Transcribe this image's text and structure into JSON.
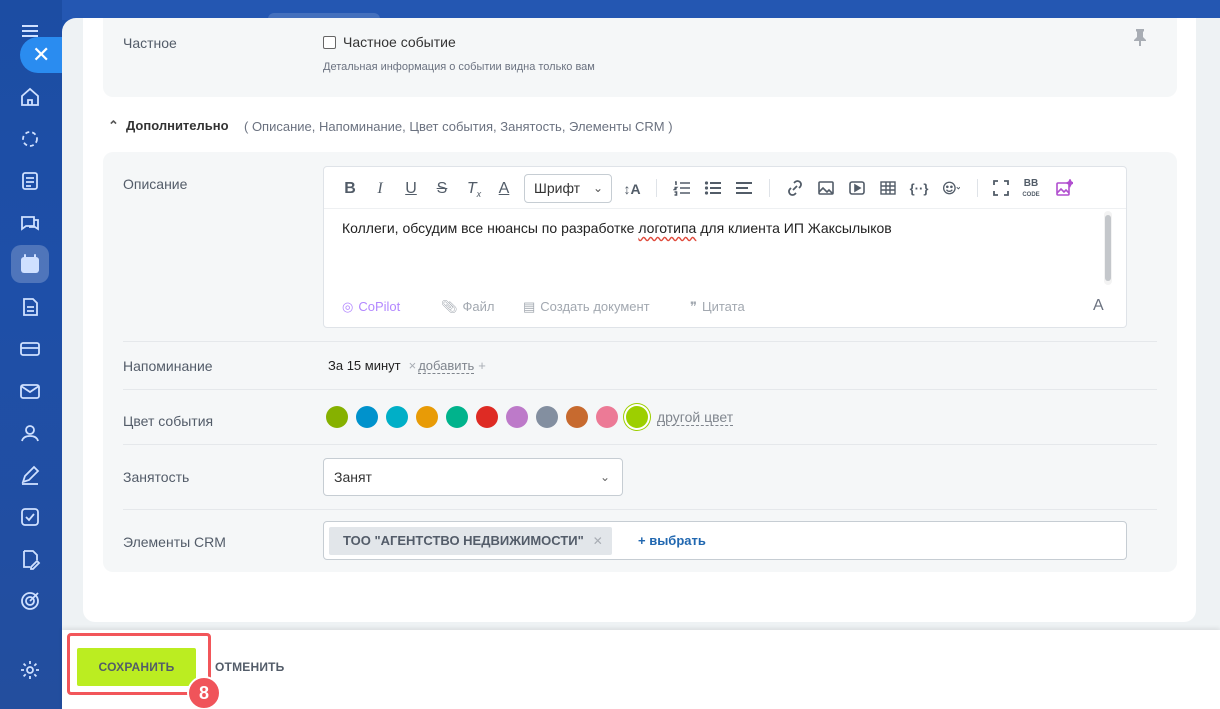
{
  "private": {
    "label": "Частное",
    "checkbox_label": "Частное событие",
    "hint": "Детальная информация о событии видна только вам"
  },
  "extra": {
    "toggle_label": "Дополнительно",
    "summary": "( Описание,  Напоминание,  Цвет события,  Занятость,  Элементы CRM )"
  },
  "description": {
    "label": "Описание",
    "font_select": "Шрифт",
    "text_before": "Коллеги, обсудим все нюансы по разработке ",
    "text_misspelled": "логотипа",
    "text_after": " для клиента ИП Жаксылыков",
    "footer": {
      "copilot": "CoPilot",
      "file": "Файл",
      "create_doc": "Создать документ",
      "quote": "Цитата"
    }
  },
  "reminder": {
    "label": "Напоминание",
    "value": "За 15 минут",
    "add_link": "добавить"
  },
  "color": {
    "label": "Цвет события",
    "swatches": [
      "#86b100",
      "#0092cc",
      "#00afc7",
      "#e89b06",
      "#00b38c",
      "#de2b24",
      "#bd7ac9",
      "#838fa0",
      "#c76a2f",
      "#ec7a96",
      "#9dcf00"
    ],
    "selected_index": 10,
    "other_link": "другой цвет"
  },
  "busy": {
    "label": "Занятость",
    "value": "Занят"
  },
  "crm": {
    "label": "Элементы CRM",
    "tag": "ТОО \"АГЕНТСТВО НЕДВИЖИМОСТИ\"",
    "add_link": "+ выбрать"
  },
  "footer": {
    "save_label": "СОХРАНИТЬ",
    "cancel_label": "ОТМЕНИТЬ",
    "step_badge": "8"
  }
}
